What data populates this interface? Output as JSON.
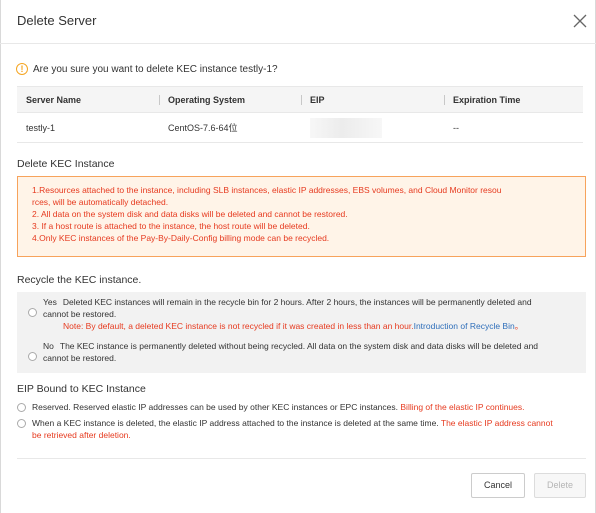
{
  "dialog": {
    "title": "Delete Server",
    "close_icon": "close-icon",
    "question": "Are you sure you want to delete KEC instance testly-1?",
    "question_icon": "warning-icon",
    "colors": {
      "warning": "#f5a623",
      "danger": "#e63a1f",
      "link": "#2f6fba",
      "notice_bg": "#fff4e8",
      "notice_border": "#f7a35c"
    }
  },
  "table": {
    "headers": [
      "Server Name",
      "Operating System",
      "EIP",
      "Expiration Time"
    ],
    "rows": [
      {
        "server_name": "testly-1",
        "os": "CentOS-7.6-64位",
        "eip": "",
        "expiration": "--"
      }
    ]
  },
  "delete_section": {
    "title": "Delete KEC Instance",
    "notices": [
      "1.Resources attached to the instance, including SLB instances, elastic IP addresses, EBS volumes, and Cloud Monitor resou",
      "rces, will be automatically detached.",
      "2. All data on the system disk and data disks will be deleted and cannot be restored.",
      "3. If a host route is attached to the instance, the host route will be deleted.",
      "4.Only KEC instances of the Pay-By-Daily-Config billing mode can be recycled."
    ]
  },
  "recycle_section": {
    "title": "Recycle the KEC instance.",
    "yes": {
      "label": "Yes",
      "line1": "Deleted KEC instances will remain in the recycle bin for 2 hours. After 2 hours, the instances will be permanently deleted and",
      "line2": "cannot be restored.",
      "note": "Note: By default, a deleted KEC instance is not recycled if it was created in less than an hour.",
      "link": "Introduction of Recycle Bin",
      "link_suffix": "。"
    },
    "no": {
      "label": "No",
      "line1": "The KEC instance is permanently deleted without being recycled. All data on the system disk and data disks will be deleted and",
      "line2": "cannot be restored."
    }
  },
  "eip_section": {
    "title": "EIP Bound to KEC Instance",
    "reserved": {
      "text": "Reserved. Reserved elastic IP addresses can be used by other KEC instances or EPC instances.",
      "warning": "Billing of the elastic IP continues."
    },
    "deleted": {
      "text": "When a KEC instance is deleted, the elastic IP address attached to the instance is deleted at the same time.",
      "warning_line1": "The elastic IP address cannot",
      "warning_line2": "be retrieved after deletion."
    }
  },
  "footer": {
    "cancel_label": "Cancel",
    "delete_label": "Delete"
  }
}
